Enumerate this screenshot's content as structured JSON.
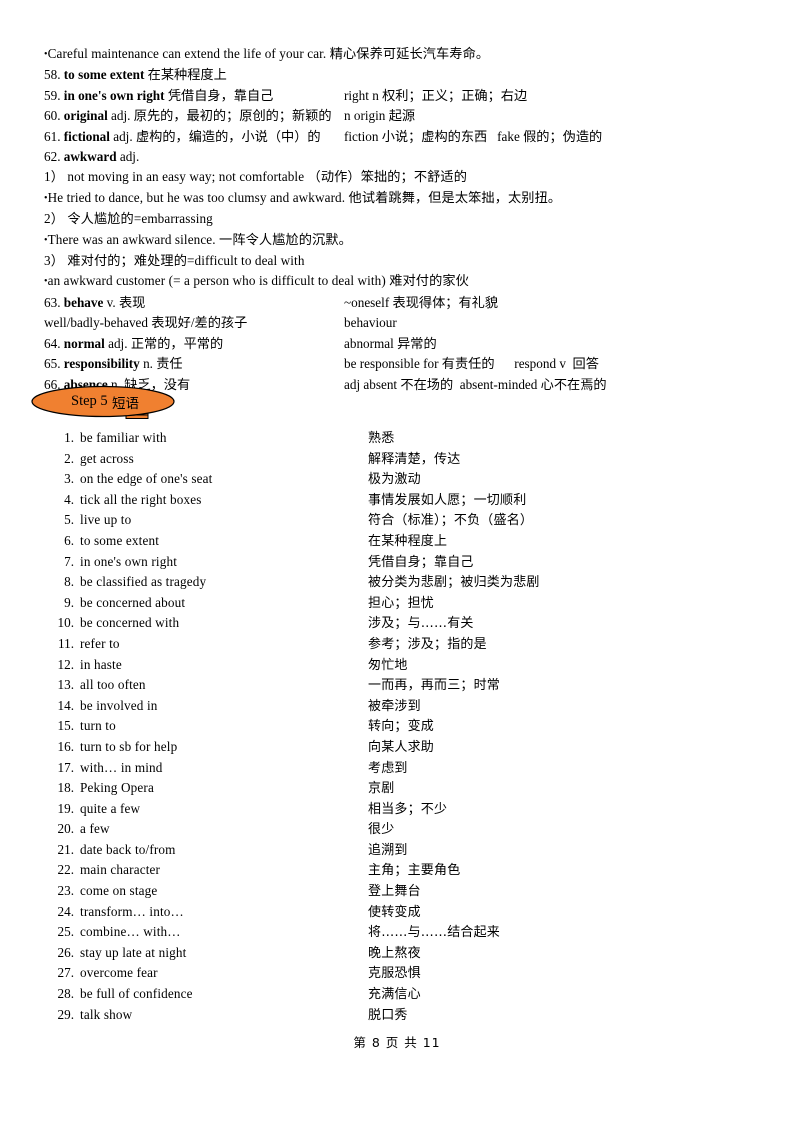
{
  "page": {
    "footer_text": "第 8 页 共 11",
    "accent_color": "#F08030",
    "text_color": "#000000",
    "background_color": "#FFFFFF"
  },
  "vocab_section": {
    "lines": [
      {
        "id": "example-careful-maintenance",
        "bullet": "•",
        "text": "Careful maintenance can extend the life of your car. 精心保养可延长汽车寿命。"
      }
    ],
    "entries": [
      {
        "number": "58.",
        "term": "to some extent",
        "pos": "",
        "meaning": "在某种程度上",
        "note": ""
      },
      {
        "number": "59.",
        "term": "in one's own right",
        "pos": "",
        "meaning": "凭借自身，靠自己",
        "note": "right n 权利；正义；正确；右边"
      },
      {
        "number": "60.",
        "term": "original",
        "pos": "adj.",
        "meaning": "原先的，最初的；原创的；新颖的",
        "note": "n origin 起源"
      },
      {
        "number": "61.",
        "term": "fictional",
        "pos": "adj.",
        "meaning": "虚构的，编造的，小说（中）的",
        "note": "fiction 小说；虚构的东西   fake 假的；伪造的"
      },
      {
        "number": "62.",
        "term": "awkward",
        "pos": "adj.",
        "meaning": "",
        "note": ""
      }
    ],
    "awkward_senses": [
      {
        "marker": "1）",
        "definition": "not moving in an easy way; not comfortable （动作）笨拙的；不舒适的",
        "example_bullet": "•",
        "example": "He tried to dance, but he was too clumsy and awkward. 他试着跳舞，但是太笨拙，太别扭。"
      },
      {
        "marker": "2）",
        "definition": "令人尴尬的=embarrassing",
        "example_bullet": "•",
        "example": "There was an awkward silence. 一阵令人尴尬的沉默。"
      },
      {
        "marker": "3）",
        "definition": "难对付的；难处理的=difficult to deal with",
        "example_bullet": "•",
        "example": "an awkward customer (= a person who is difficult to deal with) 难对付的家伙"
      }
    ],
    "entries_tail": [
      {
        "number": "63.",
        "term": "behave",
        "pos": "v.",
        "meaning": "表现",
        "note": "~oneself 表现得体；有礼貌"
      },
      {
        "number": "",
        "term": "well/badly-behaved",
        "pos": "",
        "meaning": "表现好/差的孩子",
        "note": "behaviour"
      },
      {
        "number": "64.",
        "term": "normal",
        "pos": "adj.",
        "meaning": "正常的，平常的",
        "note": "abnormal 异常的"
      },
      {
        "number": "65.",
        "term": "responsibility",
        "pos": "n.",
        "meaning": "责任",
        "note": "be responsible for 有责任的      respond v  回答"
      },
      {
        "number": "66.",
        "term": "absence",
        "pos": "n.",
        "meaning": "缺乏，没有",
        "note": "adj absent 不在场的  absent-minded 心不在焉的"
      }
    ]
  },
  "step_banner": {
    "step_label": "Step 5",
    "title": " 短语",
    "fill_color": "#F08030",
    "stroke_color": "#000000"
  },
  "phrase_section": {
    "items": [
      {
        "num": "1.",
        "en": "be familiar with",
        "zh": "熟悉"
      },
      {
        "num": "2.",
        "en": "get across",
        "zh": "解释清楚，传达"
      },
      {
        "num": "3.",
        "en": "on the edge of one's seat",
        "zh": "极为激动"
      },
      {
        "num": "4.",
        "en": "tick all the right boxes",
        "zh": "事情发展如人愿；一切顺利"
      },
      {
        "num": "5.",
        "en": "live up to",
        "zh": "符合（标准）；不负（盛名）"
      },
      {
        "num": "6.",
        "en": "to some extent",
        "zh": "在某种程度上"
      },
      {
        "num": "7.",
        "en": "in one's own right",
        "zh": "凭借自身；靠自己"
      },
      {
        "num": "8.",
        "en": "be classified as tragedy",
        "zh": "被分类为悲剧；被归类为悲剧"
      },
      {
        "num": "9.",
        "en": "be concerned about",
        "zh": "担心；担忧"
      },
      {
        "num": "10.",
        "en": "be concerned with",
        "zh": "涉及；与……有关"
      },
      {
        "num": "11.",
        "en": "refer to",
        "zh": "参考；涉及；指的是"
      },
      {
        "num": "12.",
        "en": "in haste",
        "zh": "匆忙地"
      },
      {
        "num": "13.",
        "en": "all too often",
        "zh": "一而再，再而三；时常"
      },
      {
        "num": "14.",
        "en": "be involved in",
        "zh": "被牵涉到"
      },
      {
        "num": "15.",
        "en": "turn to",
        "zh": "转向；变成"
      },
      {
        "num": "16.",
        "en": "turn to sb for help",
        "zh": "向某人求助"
      },
      {
        "num": "17.",
        "en": "with… in mind",
        "zh": "考虑到"
      },
      {
        "num": "18.",
        "en": "Peking Opera",
        "zh": "京剧"
      },
      {
        "num": "19.",
        "en": "quite a few",
        "zh": "相当多；不少"
      },
      {
        "num": "20.",
        "en": "a few",
        "zh": "很少"
      },
      {
        "num": "21.",
        "en": "date back to/from",
        "zh": "追溯到"
      },
      {
        "num": "22.",
        "en": "main character",
        "zh": "主角；主要角色"
      },
      {
        "num": "23.",
        "en": "come on stage",
        "zh": "登上舞台"
      },
      {
        "num": "24.",
        "en": "transform… into…",
        "zh": "使转变成"
      },
      {
        "num": "25.",
        "en": "combine… with…",
        "zh": "将……与……结合起来"
      },
      {
        "num": "26.",
        "en": "stay up late at night",
        "zh": "晚上熬夜"
      },
      {
        "num": "27.",
        "en": "overcome fear",
        "zh": "克服恐惧"
      },
      {
        "num": "28.",
        "en": "be full of confidence",
        "zh": "充满信心"
      },
      {
        "num": "29.",
        "en": "talk show",
        "zh": "脱口秀"
      }
    ]
  }
}
